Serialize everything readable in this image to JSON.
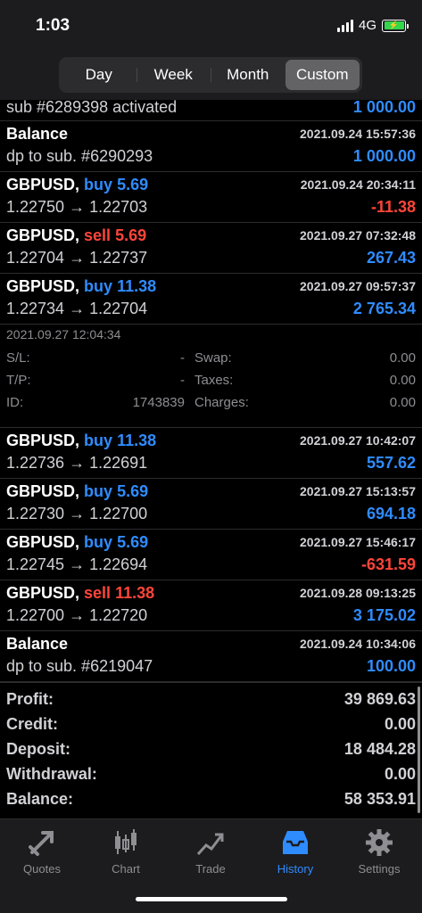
{
  "status": {
    "time": "1:03",
    "network": "4G"
  },
  "periods": [
    "Day",
    "Week",
    "Month",
    "Custom"
  ],
  "active_period": "Custom",
  "top_partial": {
    "desc": "sub #6289398 activated",
    "amount": "1 000.00"
  },
  "deals": [
    {
      "symbol": "Balance",
      "side": "",
      "volume": "",
      "time": "2021.09.24 15:57:36",
      "prices": "dp to sub. #6290293",
      "profit": "1 000.00",
      "sign": "pos"
    },
    {
      "symbol": "GBPUSD,",
      "side": "buy",
      "volume": "5.69",
      "time": "2021.09.24 20:34:11",
      "prices": "1.22750 → 1.22703",
      "profit": "-11.38",
      "sign": "neg"
    },
    {
      "symbol": "GBPUSD,",
      "side": "sell",
      "volume": "5.69",
      "time": "2021.09.27 07:32:48",
      "prices": "1.22704 → 1.22737",
      "profit": "267.43",
      "sign": "pos"
    },
    {
      "symbol": "GBPUSD,",
      "side": "buy",
      "volume": "11.38",
      "time": "2021.09.27 09:57:37",
      "prices": "1.22734 → 1.22704",
      "profit": "2 765.34",
      "sign": "pos"
    }
  ],
  "detail": {
    "time": "2021.09.27 12:04:34",
    "sl_label": "S/L:",
    "sl": "-",
    "tp_label": "T/P:",
    "tp": "-",
    "id_label": "ID:",
    "id": "1743839",
    "swap_label": "Swap:",
    "swap": "0.00",
    "taxes_label": "Taxes:",
    "taxes": "0.00",
    "charges_label": "Charges:",
    "charges": "0.00"
  },
  "deals2": [
    {
      "symbol": "GBPUSD,",
      "side": "buy",
      "volume": "11.38",
      "time": "2021.09.27 10:42:07",
      "prices": "1.22736 → 1.22691",
      "profit": "557.62",
      "sign": "pos"
    },
    {
      "symbol": "GBPUSD,",
      "side": "buy",
      "volume": "5.69",
      "time": "2021.09.27 15:13:57",
      "prices": "1.22730 → 1.22700",
      "profit": "694.18",
      "sign": "pos"
    },
    {
      "symbol": "GBPUSD,",
      "side": "buy",
      "volume": "5.69",
      "time": "2021.09.27 15:46:17",
      "prices": "1.22745 → 1.22694",
      "profit": "-631.59",
      "sign": "neg"
    },
    {
      "symbol": "GBPUSD,",
      "side": "sell",
      "volume": "11.38",
      "time": "2021.09.28 09:13:25",
      "prices": "1.22700 → 1.22720",
      "profit": "3 175.02",
      "sign": "pos"
    },
    {
      "symbol": "Balance",
      "side": "",
      "volume": "",
      "time": "2021.09.24 10:34:06",
      "prices": "dp to sub. #6219047",
      "profit": "100.00",
      "sign": "pos"
    }
  ],
  "summary": [
    {
      "label": "Profit:",
      "value": "39 869.63"
    },
    {
      "label": "Credit:",
      "value": "0.00"
    },
    {
      "label": "Deposit:",
      "value": "18 484.28"
    },
    {
      "label": "Withdrawal:",
      "value": "0.00"
    },
    {
      "label": "Balance:",
      "value": "58 353.91"
    }
  ],
  "tabs": [
    {
      "label": "Quotes",
      "icon": "quotes-icon"
    },
    {
      "label": "Chart",
      "icon": "chart-icon"
    },
    {
      "label": "Trade",
      "icon": "trade-icon"
    },
    {
      "label": "History",
      "icon": "history-icon"
    },
    {
      "label": "Settings",
      "icon": "settings-icon"
    }
  ],
  "active_tab": "History",
  "colors": {
    "accent": "#2f8cff",
    "negative": "#ff453a",
    "background": "#000000"
  }
}
